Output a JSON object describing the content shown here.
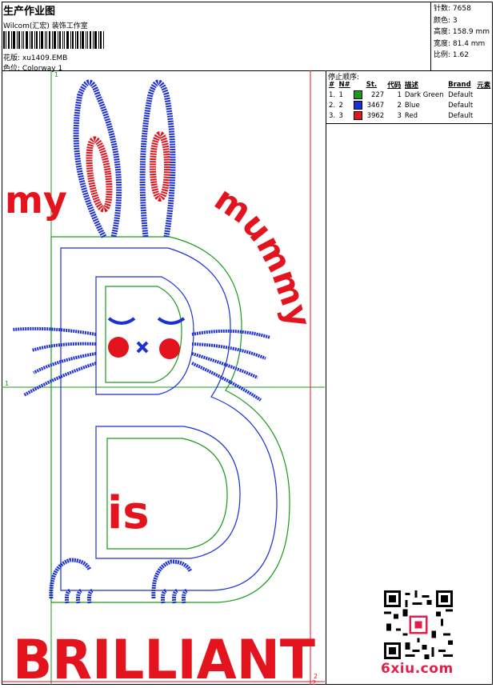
{
  "header": {
    "title": "生产作业图",
    "subtitle": "Wilcom(汇宏) 装饰工作室",
    "design_label": "花版: xu1409.EMB",
    "colorway_label": "色位: Colorway 1"
  },
  "stats": {
    "stitches": "针数: 7658",
    "colors": "颜色: 3",
    "height": "高度: 158.9 mm",
    "width": "宽度: 81.4 mm",
    "scale": "比例: 1.62"
  },
  "stop_sequence": {
    "title": "停止顺序:",
    "headers": [
      "#",
      "N#",
      "St.",
      "代码",
      "描述",
      "Brand",
      "元素"
    ],
    "rows": [
      {
        "num": "1.",
        "n": "1",
        "color": "#1a9a1a",
        "st": "227",
        "code": "1",
        "desc": "Dark Green",
        "brand": "Default"
      },
      {
        "num": "2.",
        "n": "2",
        "color": "#1c2fd6",
        "st": "3467",
        "code": "2",
        "desc": "Blue",
        "brand": "Default"
      },
      {
        "num": "3.",
        "n": "3",
        "color": "#e4141e",
        "st": "3962",
        "code": "3",
        "desc": "Red",
        "brand": "Default"
      }
    ]
  },
  "design": {
    "word_my": "my",
    "word_mummy": "mummy",
    "word_is": "is",
    "word_brilliant": "BRILLIANT",
    "guide_label_1": "1",
    "guide_label_1b": "1",
    "guide_label_2": "2",
    "guide_label_2b": "2"
  },
  "watermark": {
    "site": "6xiu.com"
  },
  "colors": {
    "red": "#e4141e",
    "blue": "#1c2fd6",
    "green": "#1a9a1a"
  }
}
